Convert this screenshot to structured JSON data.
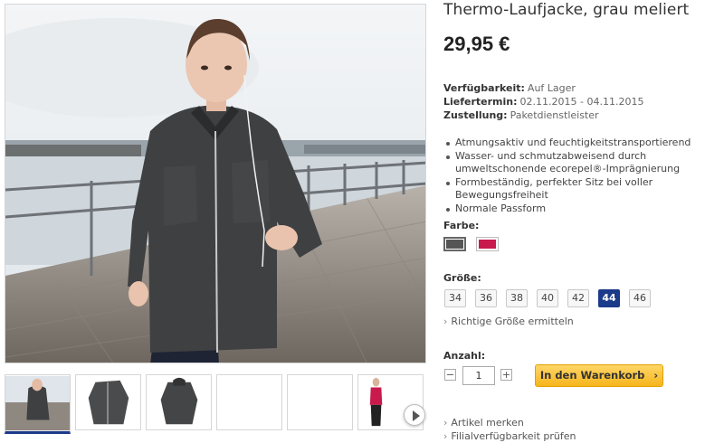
{
  "product": {
    "title": "Thermo-Laufjacke, grau meliert",
    "price": "29,95 €",
    "availability": {
      "label": "Verfügbarkeit:",
      "value": "Auf Lager"
    },
    "delivery": {
      "label": "Liefertermin:",
      "value": "02.11.2015 - 04.11.2015"
    },
    "shipping": {
      "label": "Zustellung:",
      "value": "Paketdienstleister"
    },
    "features": [
      "Atmungsaktiv und feuchtigkeitstransportierend",
      "Wasser- und schmutzabweisend durch umweltschonende ecorepel®-Imprägnierung",
      "Formbeständig, perfekter Sitz bei voller Bewegungsfreiheit",
      "Normale Passform"
    ]
  },
  "color": {
    "label": "Farbe:",
    "options": [
      {
        "name": "grau meliert",
        "hex": "#555555",
        "selected": true
      },
      {
        "name": "pink",
        "hex": "#c81a4c",
        "selected": false
      }
    ]
  },
  "size": {
    "label": "Größe:",
    "options": [
      "34",
      "36",
      "38",
      "40",
      "42",
      "44",
      "46"
    ],
    "selected": "44",
    "help_link": "Richtige Größe ermitteln"
  },
  "quantity": {
    "label": "Anzahl:",
    "value": "1",
    "minus": "−",
    "plus": "+"
  },
  "cart_button": "In den Warenkorb",
  "links": {
    "wishlist": "Artikel merken",
    "store_check": "Filialverfügbarkeit prüfen"
  },
  "icons": {
    "link_chevron": "chevron-right-icon",
    "cart_arrow": "chevron-right-icon",
    "gallery_next": "play-next-icon"
  }
}
